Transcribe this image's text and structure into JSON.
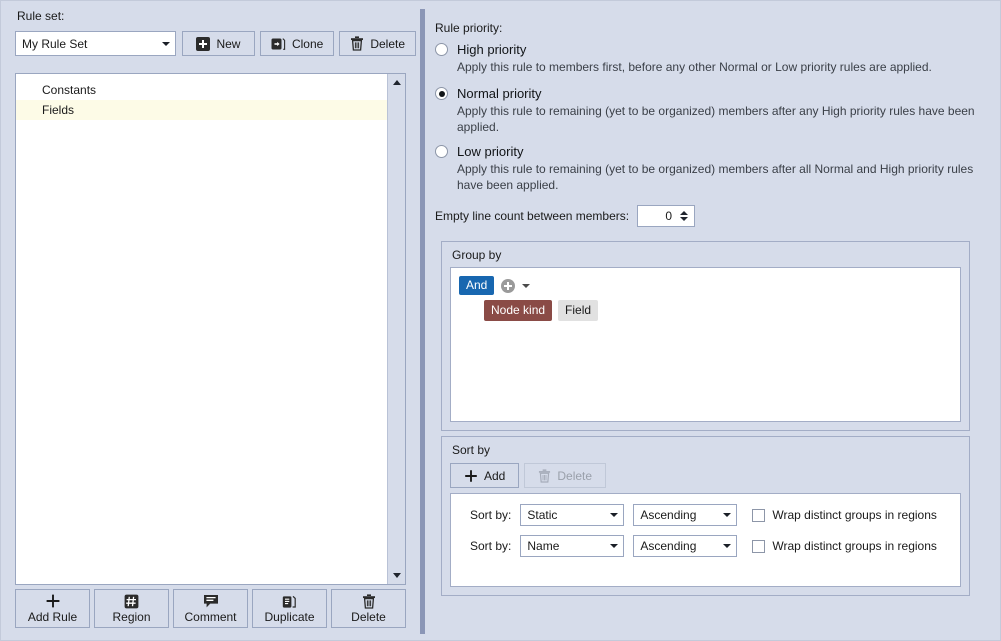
{
  "left": {
    "ruleset_label": "Rule set:",
    "ruleset_value": "My Rule Set",
    "toolbar": [
      {
        "label": "New",
        "icon": "plus-square-icon"
      },
      {
        "label": "Clone",
        "icon": "clone-icon"
      },
      {
        "label": "Delete",
        "icon": "trash-icon"
      }
    ],
    "list_items": [
      {
        "label": "Constants",
        "highlighted": false
      },
      {
        "label": "Fields",
        "highlighted": true
      }
    ],
    "bottom_toolbar": [
      {
        "label": "Add Rule",
        "icon": "plus-icon"
      },
      {
        "label": "Region",
        "icon": "region-hash-icon"
      },
      {
        "label": "Comment",
        "icon": "comment-icon"
      },
      {
        "label": "Duplicate",
        "icon": "duplicate-icon"
      },
      {
        "label": "Delete",
        "icon": "trash-icon"
      }
    ]
  },
  "right": {
    "priority_label": "Rule priority:",
    "priorities": [
      {
        "title": "High priority",
        "desc": "Apply this rule to members first, before any other Normal or Low priority rules are applied.",
        "selected": false
      },
      {
        "title": "Normal priority",
        "desc": "Apply this rule to remaining (yet to be organized) members after any High priority rules have been applied.",
        "selected": true
      },
      {
        "title": "Low priority",
        "desc": "Apply this rule to remaining (yet to be organized) members after all Normal and High priority rules have been applied.",
        "selected": false
      }
    ],
    "empty_line_label": "Empty line count between members:",
    "empty_line_value": "0",
    "group_by": {
      "title": "Group by",
      "operator_chip": "And",
      "add_icon": "plus-circle-icon",
      "caret_icon": "chevron-down-icon",
      "chips": [
        {
          "label": "Node kind",
          "style": "red"
        },
        {
          "label": "Field",
          "style": "gray"
        }
      ]
    },
    "sort_by": {
      "title": "Sort by",
      "add_label": "Add",
      "delete_label": "Delete",
      "delete_disabled": true,
      "rows": [
        {
          "label": "Sort by:",
          "field": "Static",
          "direction": "Ascending",
          "wrap_label": "Wrap distinct groups in regions",
          "wrap_checked": false
        },
        {
          "label": "Sort by:",
          "field": "Name",
          "direction": "Ascending",
          "wrap_label": "Wrap distinct groups in regions",
          "wrap_checked": false
        }
      ]
    }
  },
  "colors": {
    "window_bg": "#d6dcea",
    "border": "#9aa6c0",
    "accent_blue": "#1867b0",
    "chip_red": "#8a4b46",
    "chip_gray": "#e1e1e1",
    "highlight_row": "#fdfbe7",
    "splitter": "#8b96b6"
  }
}
